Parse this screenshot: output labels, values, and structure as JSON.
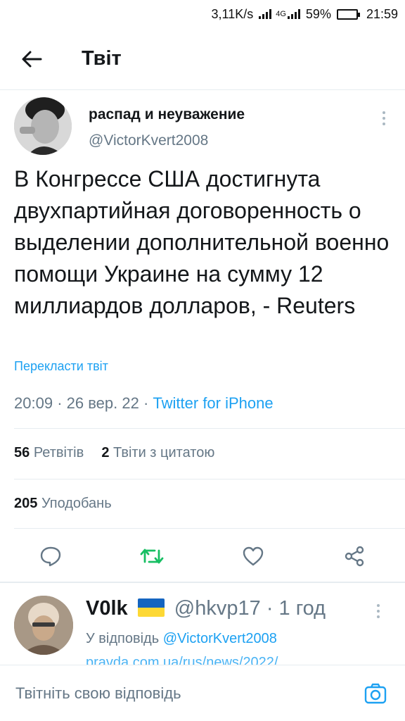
{
  "status_bar": {
    "speed": "3,11K/s",
    "network": "4G",
    "battery": "59%",
    "battery_level": 0.59,
    "time": "21:59"
  },
  "header": {
    "title": "Твіт"
  },
  "tweet": {
    "author_name": "распад и неуважение",
    "author_handle": "@VictorKvert2008",
    "text": "В Конгрессе США достигнута двухпартийная договоренность о выделении дополнительной военно помощи Украине на сумму 12 миллиардов долларов, - Reuters",
    "translate": "Перекласти твіт",
    "time": "20:09",
    "date": "26 вер. 22",
    "separator": "·",
    "source": "Twitter for iPhone",
    "retweets_count": "56",
    "retweets_label": "Ретвітів",
    "quotes_count": "2",
    "quotes_label": "Твіти з цитатою",
    "likes_count": "205",
    "likes_label": "Уподобань"
  },
  "reply": {
    "name": "V0lk",
    "handle": "@hkvp17",
    "separator": "·",
    "time": "1 год",
    "reply_to_label": "У відповідь",
    "reply_to_handle": "@VictorKvert2008",
    "cut_text": "pravda.com.ua/rus/news/2022/"
  },
  "composer": {
    "placeholder": "Твітніть свою відповідь"
  },
  "icons": {
    "back": "arrow-left-icon",
    "more": "more-vertical-icon",
    "reply": "comment-icon",
    "retweet": "retweet-icon",
    "like": "heart-icon",
    "share": "share-icon",
    "camera": "camera-icon"
  },
  "colors": {
    "accent": "#1da1f2",
    "retweet": "#17bf63",
    "secondary_text": "#657786",
    "battery_fill": "#21c124"
  }
}
